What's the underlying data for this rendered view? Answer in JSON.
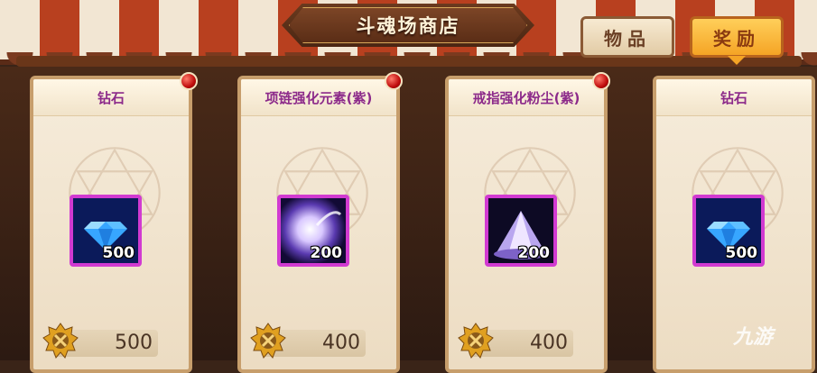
{
  "shop": {
    "title": "斗魂场商店"
  },
  "tabs": [
    {
      "label": "物品",
      "active": false
    },
    {
      "label": "奖励",
      "active": true
    }
  ],
  "items": [
    {
      "name": "钻石",
      "icon": "diamond-icon",
      "quantity": "500",
      "price": "500"
    },
    {
      "name": "项链强化元素(紫)",
      "icon": "purple-orb-icon",
      "quantity": "200",
      "price": "400"
    },
    {
      "name": "戒指强化粉尘(紫)",
      "icon": "purple-dust-icon",
      "quantity": "200",
      "price": "400"
    },
    {
      "name": "钻石",
      "icon": "diamond-icon",
      "quantity": "500",
      "price": ""
    }
  ],
  "currency_icon": "arena-coin-icon",
  "watermark": {
    "text": "九游"
  },
  "colors": {
    "item_name": "#8c2a8a",
    "icon_border": "#d13ad1",
    "active_tab": "#f5a425"
  }
}
